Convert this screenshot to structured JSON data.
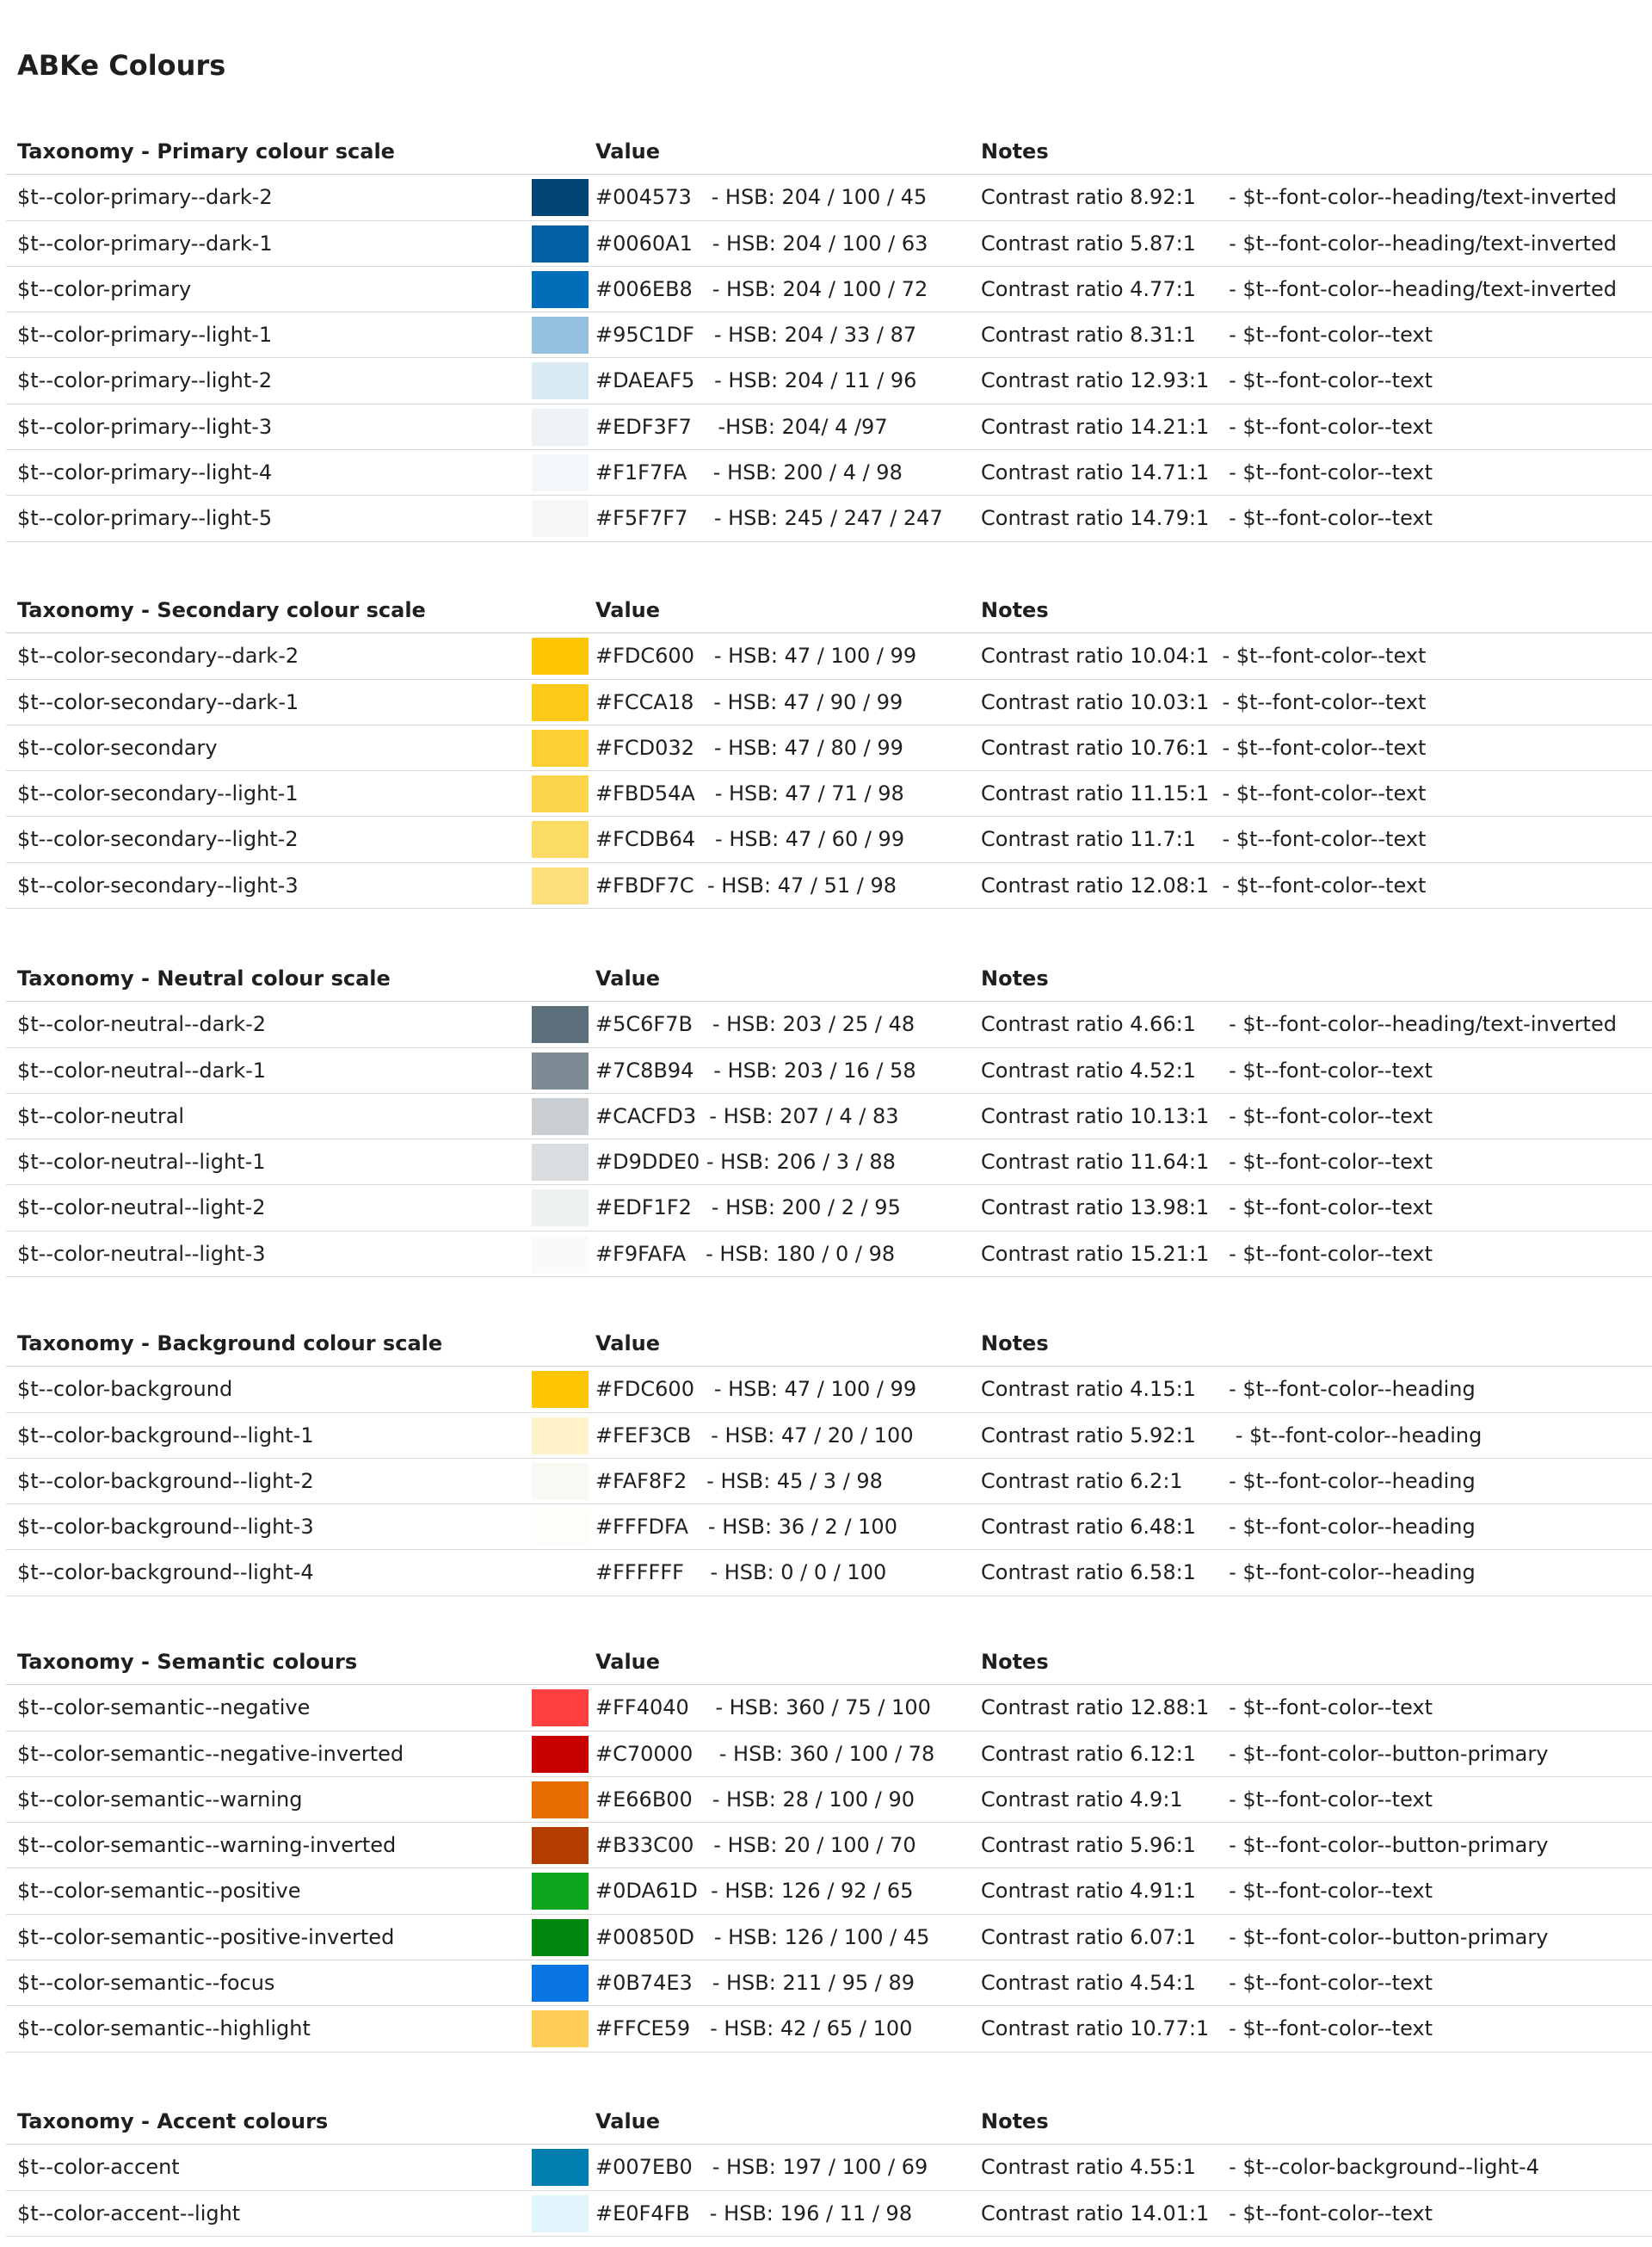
{
  "title": "ABKe Colours",
  "sections": [
    {
      "header": {
        "name": "Taxonomy - Primary colour scale",
        "value": "Value",
        "notes": "Notes"
      },
      "rows": [
        {
          "name": "$t--color-primary--dark-2",
          "swatch": "#004573",
          "value": "#004573   - HSB: 204 / 100 / 45",
          "notes": "Contrast ratio 8.92:1     - $t--font-color--heading/text-inverted"
        },
        {
          "name": "$t--color-primary--dark-1",
          "swatch": "#0060A1",
          "value": "#0060A1   - HSB: 204 / 100 / 63",
          "notes": "Contrast ratio 5.87:1     - $t--font-color--heading/text-inverted"
        },
        {
          "name": "$t--color-primary",
          "swatch": "#006EB8",
          "value": "#006EB8   - HSB: 204 / 100 / 72",
          "notes": "Contrast ratio 4.77:1     - $t--font-color--heading/text-inverted"
        },
        {
          "name": "$t--color-primary--light-1",
          "swatch": "#95C1DF",
          "value": "#95C1DF   - HSB: 204 / 33 / 87",
          "notes": "Contrast ratio 8.31:1     - $t--font-color--text"
        },
        {
          "name": "$t--color-primary--light-2",
          "swatch": "#DAEAF5",
          "value": "#DAEAF5   - HSB: 204 / 11 / 96",
          "notes": "Contrast ratio 12.93:1   - $t--font-color--text"
        },
        {
          "name": "$t--color-primary--light-3",
          "swatch": "#EDF3F7",
          "value": "#EDF3F7    -HSB: 204/ 4 /97",
          "notes": "Contrast ratio 14.21:1   - $t--font-color--text"
        },
        {
          "name": "$t--color-primary--light-4",
          "swatch": "#F1F7FA",
          "value": "#F1F7FA    - HSB: 200 / 4 / 98",
          "notes": "Contrast ratio 14.71:1   - $t--font-color--text"
        },
        {
          "name": "$t--color-primary--light-5",
          "swatch": "#F5F7F7",
          "value": "#F5F7F7    - HSB: 245 / 247 / 247",
          "notes": "Contrast ratio 14.79:1   - $t--font-color--text"
        }
      ]
    },
    {
      "header": {
        "name": "Taxonomy - Secondary colour scale",
        "value": "Value",
        "notes": "Notes"
      },
      "rows": [
        {
          "name": "$t--color-secondary--dark-2",
          "swatch": "#FDC600",
          "value": "#FDC600   - HSB: 47 / 100 / 99",
          "notes": "Contrast ratio 10.04:1  - $t--font-color--text"
        },
        {
          "name": "$t--color-secondary--dark-1",
          "swatch": "#FCCA18",
          "value": "#FCCA18   - HSB: 47 / 90 / 99",
          "notes": "Contrast ratio 10.03:1  - $t--font-color--text"
        },
        {
          "name": "$t--color-secondary",
          "swatch": "#FCD032",
          "value": "#FCD032   - HSB: 47 / 80 / 99",
          "notes": "Contrast ratio 10.76:1  - $t--font-color--text"
        },
        {
          "name": "$t--color-secondary--light-1",
          "swatch": "#FBD54A",
          "value": "#FBD54A   - HSB: 47 / 71 / 98",
          "notes": "Contrast ratio 11.15:1  - $t--font-color--text"
        },
        {
          "name": "$t--color-secondary--light-2",
          "swatch": "#FCDB64",
          "value": "#FCDB64   - HSB: 47 / 60 / 99",
          "notes": "Contrast ratio 11.7:1    - $t--font-color--text"
        },
        {
          "name": "$t--color-secondary--light-3",
          "swatch": "#FBDF7C",
          "value": "#FBDF7C  - HSB: 47 / 51 / 98",
          "notes": "Contrast ratio 12.08:1  - $t--font-color--text"
        }
      ]
    },
    {
      "header": {
        "name": "Taxonomy - Neutral colour scale",
        "value": "Value",
        "notes": "Notes"
      },
      "rows": [
        {
          "name": "$t--color-neutral--dark-2",
          "swatch": "#5C6F7B",
          "value": "#5C6F7B   - HSB: 203 / 25 / 48",
          "notes": "Contrast ratio 4.66:1     - $t--font-color--heading/text-inverted"
        },
        {
          "name": "$t--color-neutral--dark-1",
          "swatch": "#7C8B94",
          "value": "#7C8B94   - HSB: 203 / 16 / 58",
          "notes": "Contrast ratio 4.52:1     - $t--font-color--text"
        },
        {
          "name": "$t--color-neutral",
          "swatch": "#CACFD3",
          "value": "#CACFD3  - HSB: 207 / 4 / 83",
          "notes": "Contrast ratio 10.13:1   - $t--font-color--text"
        },
        {
          "name": "$t--color-neutral--light-1",
          "swatch": "#D9DDE0",
          "value": "#D9DDE0 - HSB: 206 / 3 / 88",
          "notes": "Contrast ratio 11.64:1   - $t--font-color--text"
        },
        {
          "name": "$t--color-neutral--light-2",
          "swatch": "#EDF1F2",
          "value": "#EDF1F2   - HSB: 200 / 2 / 95",
          "notes": "Contrast ratio 13.98:1   - $t--font-color--text"
        },
        {
          "name": "$t--color-neutral--light-3",
          "swatch": "#F9FAFA",
          "value": "#F9FAFA   - HSB: 180 / 0 / 98",
          "notes": "Contrast ratio 15.21:1   - $t--font-color--text"
        }
      ]
    },
    {
      "header": {
        "name": "Taxonomy - Background colour scale",
        "value": "Value",
        "notes": "Notes"
      },
      "rows": [
        {
          "name": "$t--color-background",
          "swatch": "#FDC600",
          "value": "#FDC600   - HSB: 47 / 100 / 99",
          "notes": "Contrast ratio 4.15:1     - $t--font-color--heading"
        },
        {
          "name": "$t--color-background--light-1",
          "swatch": "#FEF3CB",
          "value": "#FEF3CB   - HSB: 47 / 20 / 100",
          "notes": "Contrast ratio 5.92:1      - $t--font-color--heading"
        },
        {
          "name": "$t--color-background--light-2",
          "swatch": "#FAF8F2",
          "value": "#FAF8F2   - HSB: 45 / 3 / 98",
          "notes": "Contrast ratio 6.2:1       - $t--font-color--heading"
        },
        {
          "name": "$t--color-background--light-3",
          "swatch": "#FFFDFA",
          "value": "#FFFDFA   - HSB: 36 / 2 / 100",
          "notes": "Contrast ratio 6.48:1     - $t--font-color--heading"
        },
        {
          "name": "$t--color-background--light-4",
          "swatch": "#FFFFFF",
          "value": "#FFFFFF    - HSB: 0 / 0 / 100",
          "notes": "Contrast ratio 6.58:1     - $t--font-color--heading"
        }
      ]
    },
    {
      "header": {
        "name": "Taxonomy - Semantic colours",
        "value": "Value",
        "notes": "Notes"
      },
      "rows": [
        {
          "name": "$t--color-semantic--negative",
          "swatch": "#FF4040",
          "value": "#FF4040    - HSB: 360 / 75 / 100",
          "notes": "Contrast ratio 12.88:1   - $t--font-color--text"
        },
        {
          "name": "$t--color-semantic--negative-inverted",
          "swatch": "#C70000",
          "value": "#C70000    - HSB: 360 / 100 / 78",
          "notes": "Contrast ratio 6.12:1     - $t--font-color--button-primary"
        },
        {
          "name": "$t--color-semantic--warning",
          "swatch": "#E66B00",
          "value": "#E66B00   - HSB: 28 / 100 / 90",
          "notes": "Contrast ratio 4.9:1       - $t--font-color--text"
        },
        {
          "name": "$t--color-semantic--warning-inverted",
          "swatch": "#B33C00",
          "value": "#B33C00   - HSB: 20 / 100 / 70",
          "notes": "Contrast ratio 5.96:1     - $t--font-color--button-primary"
        },
        {
          "name": "$t--color-semantic--positive",
          "swatch": "#0DA61D",
          "value": "#0DA61D  - HSB: 126 / 92 / 65",
          "notes": "Contrast ratio 4.91:1     - $t--font-color--text"
        },
        {
          "name": "$t--color-semantic--positive-inverted",
          "swatch": "#00850D",
          "value": "#00850D   - HSB: 126 / 100 / 45",
          "notes": "Contrast ratio 6.07:1     - $t--font-color--button-primary"
        },
        {
          "name": "$t--color-semantic--focus",
          "swatch": "#0B74E3",
          "value": "#0B74E3   - HSB: 211 / 95 / 89",
          "notes": "Contrast ratio 4.54:1     - $t--font-color--text"
        },
        {
          "name": "$t--color-semantic--highlight",
          "swatch": "#FFCE59",
          "value": "#FFCE59   - HSB: 42 / 65 / 100",
          "notes": "Contrast ratio 10.77:1   - $t--font-color--text"
        }
      ]
    },
    {
      "header": {
        "name": "Taxonomy - Accent colours",
        "value": "Value",
        "notes": "Notes"
      },
      "rows": [
        {
          "name": "$t--color-accent",
          "swatch": "#007EB0",
          "value": "#007EB0   - HSB: 197 / 100 / 69",
          "notes": "Contrast ratio 4.55:1     - $t--color-background--light-4"
        },
        {
          "name": "$t--color-accent--light",
          "swatch": "#E0F4FB",
          "value": "#E0F4FB   - HSB: 196 / 11 / 98",
          "notes": "Contrast ratio 14.01:1   - $t--font-color--text"
        }
      ]
    }
  ]
}
